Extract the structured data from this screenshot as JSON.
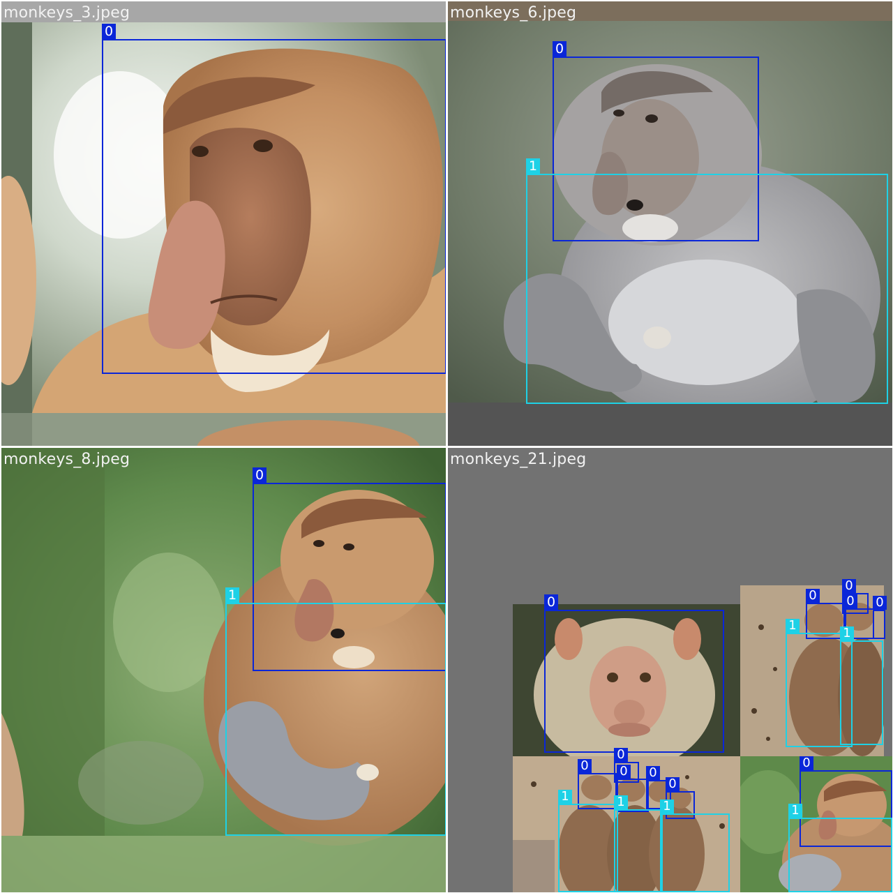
{
  "mosaic": {
    "tiles": [
      {
        "filename": "monkeys_3.jpeg"
      },
      {
        "filename": "monkeys_6.jpeg"
      },
      {
        "filename": "monkeys_8.jpeg"
      },
      {
        "filename": "monkeys_21.jpeg"
      }
    ],
    "labels": {
      "class0": "0",
      "class1": "1"
    },
    "colors": {
      "class0": "#0a26d8",
      "class1": "#1ed1e6",
      "padding": "#727272"
    }
  }
}
